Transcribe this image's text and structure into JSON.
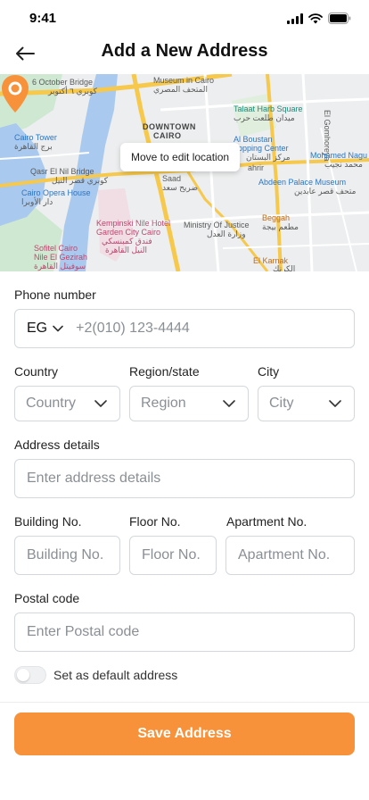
{
  "status_bar": {
    "time": "9:41"
  },
  "header": {
    "title": "Add a New Address"
  },
  "map": {
    "tooltip": "Move to edit location",
    "labels": {
      "october_bridge": "6 October Bridge",
      "october_bridge_ar": "كوبري ٦ أكتوبر",
      "museum": "Museum in Cairo",
      "museum_ar": "المتحف المصري",
      "downtown": "DOWNTOWN",
      "cairo": "CAIRO",
      "talaat": "Talaat Harb Square",
      "talaat_ar": "ميدان طلعت حرب",
      "gomhoreya": "El Gomhoreya",
      "tower": "Cairo Tower",
      "tower_ar": "برج القاهرة",
      "boustan": "Al Boustan",
      "boustan2": "hopping Center",
      "boustan_ar": "مركز البستان",
      "mohamed": "Mohamed Nagu",
      "mohamed_ar": "محمد نجيب",
      "qasr": "Qasr El Nil Bridge",
      "qasr_ar": "كوبري قصر النيل",
      "saad": "Saad",
      "saad_ar": "ضريح سعد",
      "tahrir": "ahrir",
      "abdeen": "Abdeen Palace Museum",
      "abdeen_ar": "متحف قصر عابدين",
      "opera": "Cairo Opera House",
      "opera_ar": "دار الأوبرا",
      "kempinski": "Kempinski Nile Hotel",
      "kempinski2": "Garden City Cairo",
      "kempinski_ar": "فندق كمبنسكي",
      "kempinski_ar2": "النيل القاهرة",
      "justice": "Ministry Of Justice",
      "justice_ar": "وزارة العدل",
      "beggah": "Beggah",
      "beggah_ar": "مطعم بيجة",
      "sofitel": "Sofitel Cairo",
      "sofitel2": "Nile El Gezirah",
      "sofitel_ar": "سوفيتل القاهرة",
      "sofitel_ar2": "نيل الجزيرة",
      "karnak": "El Karnak",
      "karnak_ar": "الكرنك"
    }
  },
  "form": {
    "phone": {
      "label": "Phone number",
      "country_code": "EG",
      "placeholder": "+2(010) 123-4444"
    },
    "country": {
      "label": "Country",
      "value": "Country"
    },
    "region": {
      "label": "Region/state",
      "value": "Region"
    },
    "city": {
      "label": "City",
      "value": "City"
    },
    "address": {
      "label": "Address details",
      "placeholder": "Enter address details"
    },
    "building": {
      "label": "Building No.",
      "placeholder": "Building No."
    },
    "floor": {
      "label": "Floor  No.",
      "placeholder": "Floor No."
    },
    "apartment": {
      "label": "Apartment No.",
      "placeholder": "Apartment No."
    },
    "postal": {
      "label": "Postal code",
      "placeholder": "Enter Postal code"
    },
    "default_toggle": {
      "label": "Set as default address",
      "checked": false
    }
  },
  "actions": {
    "save_label": "Save Address"
  },
  "colors": {
    "accent": "#F7923A",
    "border": "#D4D8DC",
    "placeholder": "#8A8F94"
  }
}
